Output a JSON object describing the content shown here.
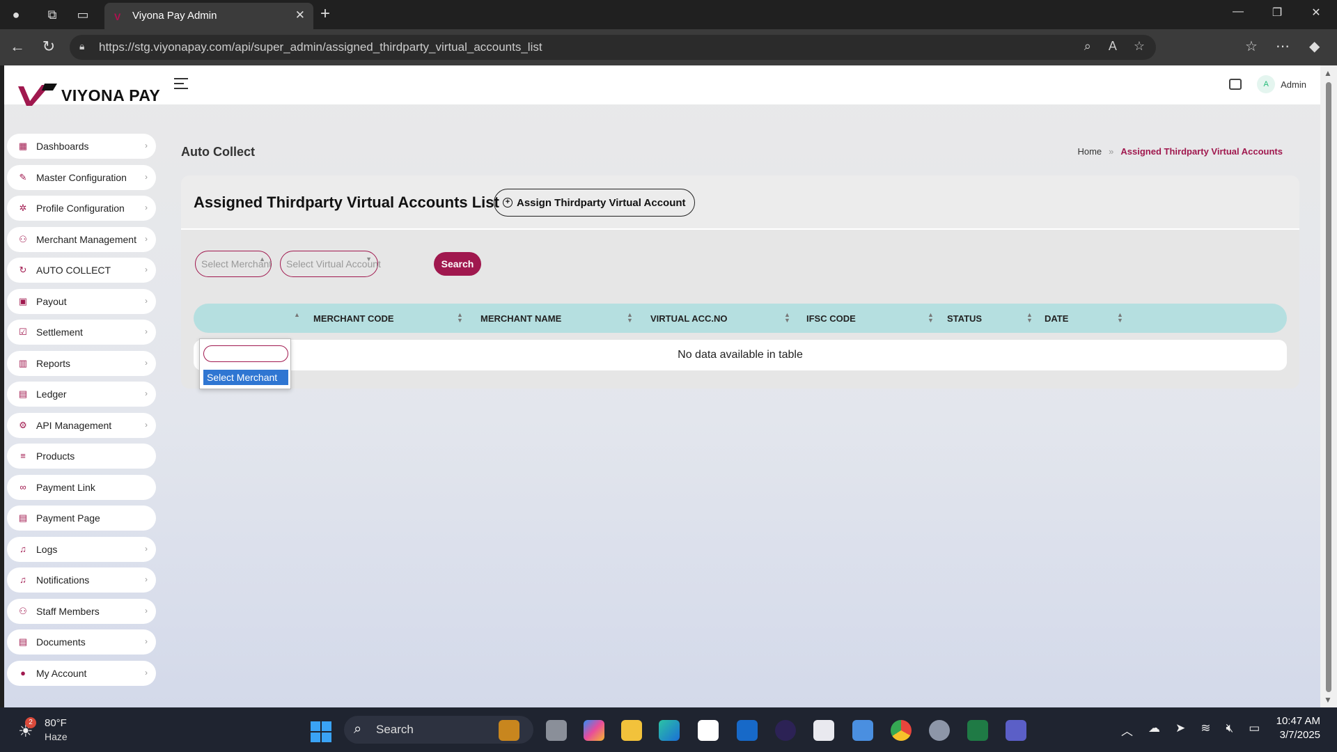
{
  "browser": {
    "tab_title": "Viyona Pay Admin",
    "url": "https://stg.viyonapay.com/api/super_admin/assigned_thirdparty_virtual_accounts_list"
  },
  "brand": {
    "name": "VIYONA PAY",
    "accent": "#a0184e"
  },
  "header": {
    "user_initial": "A",
    "user_name": "Admin"
  },
  "sidebar": {
    "items": [
      {
        "label": "Dashboards",
        "icon": "grid-icon"
      },
      {
        "label": "Master Configuration",
        "icon": "tools-icon"
      },
      {
        "label": "Profile Configuration",
        "icon": "gear-icon"
      },
      {
        "label": "Merchant Management",
        "icon": "users-icon"
      },
      {
        "label": "AUTO COLLECT",
        "icon": "refresh-icon"
      },
      {
        "label": "Payout",
        "icon": "wallet-icon"
      },
      {
        "label": "Settlement",
        "icon": "check-icon"
      },
      {
        "label": "Reports",
        "icon": "bar-chart-icon"
      },
      {
        "label": "Ledger",
        "icon": "book-icon"
      },
      {
        "label": "API Management",
        "icon": "cog-icon"
      },
      {
        "label": "Products",
        "icon": "list-icon"
      },
      {
        "label": "Payment Link",
        "icon": "link-icon"
      },
      {
        "label": "Payment Page",
        "icon": "document-icon"
      },
      {
        "label": "Logs",
        "icon": "bell-icon"
      },
      {
        "label": "Notifications",
        "icon": "bell-icon"
      },
      {
        "label": "Staff Members",
        "icon": "users-icon"
      },
      {
        "label": "Documents",
        "icon": "document-icon"
      },
      {
        "label": "My Account",
        "icon": "user-circle-icon"
      }
    ]
  },
  "page": {
    "title": "Auto Collect",
    "breadcrumb": {
      "home": "Home",
      "current": "Assigned Thirdparty Virtual Accounts"
    },
    "list_title": "Assigned Thirdparty Virtual Accounts List",
    "assign_button": "Assign Thirdparty Virtual Account"
  },
  "filters": {
    "merchant_placeholder": "Select Merchant",
    "virtual_account_placeholder": "Select Virtual Account",
    "search_button": "Search",
    "dropdown_option": "Select Merchant"
  },
  "table": {
    "columns": [
      "MERCHANT CODE",
      "MERCHANT NAME",
      "VIRTUAL ACC.NO",
      "IFSC CODE",
      "STATUS",
      "DATE"
    ],
    "empty_message": "No data available in table"
  },
  "taskbar": {
    "weather_temp": "80°F",
    "weather_desc": "Haze",
    "weather_badge": "2",
    "search_label": "Search",
    "time": "10:47 AM",
    "date": "3/7/2025"
  }
}
